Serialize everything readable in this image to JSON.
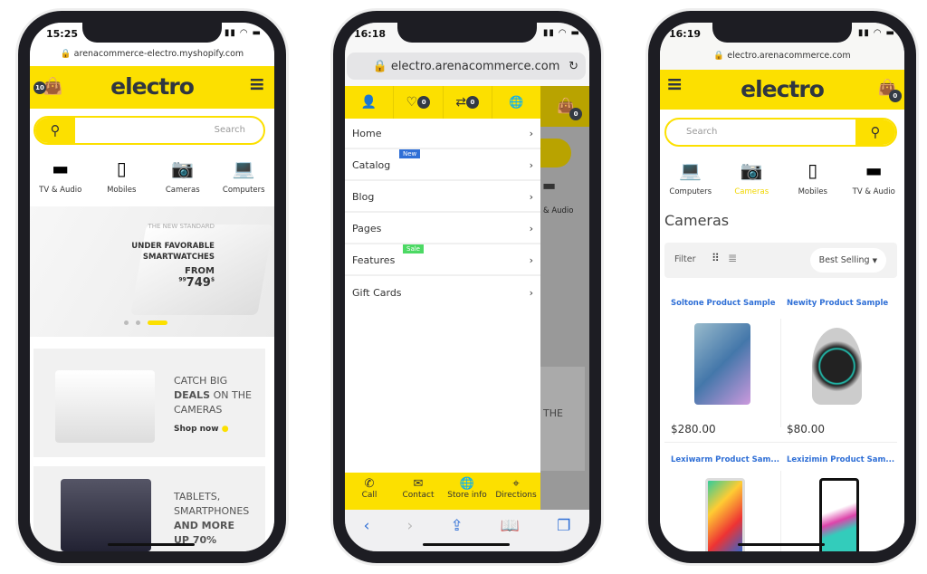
{
  "colors": {
    "brand": "#fce000",
    "dark": "#2f3640",
    "link": "#2f6fd6"
  },
  "phone1": {
    "time": "15:25",
    "url": "arenacommerce-electro.myshopify.com",
    "logo": "electro",
    "cart_count": "10",
    "search_placeholder": "Search",
    "categories": [
      {
        "label": "TV & Audio",
        "icon": "tv-icon"
      },
      {
        "label": "Mobiles",
        "icon": "mobile-icon"
      },
      {
        "label": "Cameras",
        "icon": "camera-icon"
      },
      {
        "label": "Computers",
        "icon": "laptop-icon"
      }
    ],
    "hero": {
      "kicker": "THE NEW STANDARD",
      "line1": "UNDER FAVORABLE",
      "line2": "SMARTWATCHES",
      "from": "FROM",
      "cents": "99",
      "price": "749",
      "currency": "$",
      "active_slide": 3,
      "slides": 3
    },
    "banner1": {
      "line1": "CATCH BIG",
      "bold": "DEALS",
      "line2": " ON THE",
      "line3": "CAMERAS",
      "cta": "Shop now"
    },
    "banner2": {
      "line1": "TABLETS,",
      "line2": "SMARTPHONES",
      "bold": "AND MORE",
      "partial": "UP 70%"
    }
  },
  "phone2": {
    "time": "16:18",
    "url": "electro.arenacommerce.com",
    "top_icons": [
      {
        "icon": "user-icon"
      },
      {
        "icon": "heart-icon",
        "count": "0"
      },
      {
        "icon": "compare-icon",
        "count": "0"
      },
      {
        "icon": "globe-icon"
      }
    ],
    "cart_count": "0",
    "menu": [
      {
        "label": "Home"
      },
      {
        "label": "Catalog",
        "tag": "New",
        "tag_color": "#2f6fd6"
      },
      {
        "label": "Blog"
      },
      {
        "label": "Pages"
      },
      {
        "label": "Features",
        "tag": "Sale",
        "tag_color": "#4cd964"
      },
      {
        "label": "Gift Cards"
      }
    ],
    "bottom_bar": [
      {
        "label": "Call",
        "icon": "phone-icon"
      },
      {
        "label": "Contact",
        "icon": "mail-icon"
      },
      {
        "label": "Store info",
        "icon": "globe-icon"
      },
      {
        "label": "Directions",
        "icon": "location-icon"
      }
    ],
    "behind": {
      "cat": "& Audio",
      "text": "THE"
    }
  },
  "phone3": {
    "time": "16:19",
    "url": "electro.arenacommerce.com",
    "logo": "electro",
    "cart_count": "0",
    "search_placeholder": "Search",
    "categories": [
      {
        "label": "Computers"
      },
      {
        "label": "Cameras",
        "active": true
      },
      {
        "label": "Mobiles"
      },
      {
        "label": "TV & Audio"
      }
    ],
    "page_title": "Cameras",
    "filter_label": "Filter",
    "sort": "Best Selling",
    "products": [
      {
        "title": "Soltone Product Sample",
        "price": "$280.00"
      },
      {
        "title": "Newity Product Sample",
        "price": "$80.00"
      },
      {
        "title": "Lexiwarm Product Sam...",
        "price": ""
      },
      {
        "title": "Lexizimin Product Sam...",
        "price": ""
      }
    ]
  }
}
